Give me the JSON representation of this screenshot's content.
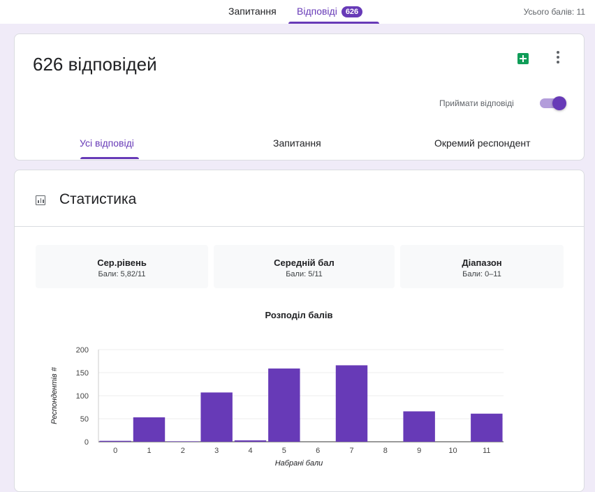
{
  "topbar": {
    "tab_questions": "Запитання",
    "tab_responses": "Відповіді",
    "responses_badge": "626",
    "total_points": "Усього балів: 11"
  },
  "summary": {
    "response_count": "626 відповідей",
    "accepting_label": "Приймати відповіді",
    "accepting_on": true,
    "subtabs": [
      "Усі відповіді",
      "Запитання",
      "Окремий респондент"
    ]
  },
  "stats": {
    "title": "Статистика",
    "cards": [
      {
        "title": "Сер.рівень",
        "value": "Бали: 5,82/11"
      },
      {
        "title": "Середній бал",
        "value": "Бали: 5/11"
      },
      {
        "title": "Діапазон",
        "value": "Бали: 0–11"
      }
    ]
  },
  "chart_data": {
    "type": "bar",
    "title": "Розподіл балів",
    "xlabel": "Набрані бали",
    "ylabel": "Респондентів #",
    "categories": [
      "0",
      "1",
      "2",
      "3",
      "4",
      "5",
      "6",
      "7",
      "8",
      "9",
      "10",
      "11"
    ],
    "values": [
      2,
      53,
      1,
      107,
      3,
      159,
      0,
      166,
      0,
      66,
      0,
      61
    ],
    "ylim": [
      0,
      200
    ],
    "yticks": [
      0,
      50,
      100,
      150,
      200
    ],
    "grid": true,
    "bar_color": "#673ab7"
  },
  "colors": {
    "accent": "#673ab7",
    "background": "#f0ebf8"
  }
}
